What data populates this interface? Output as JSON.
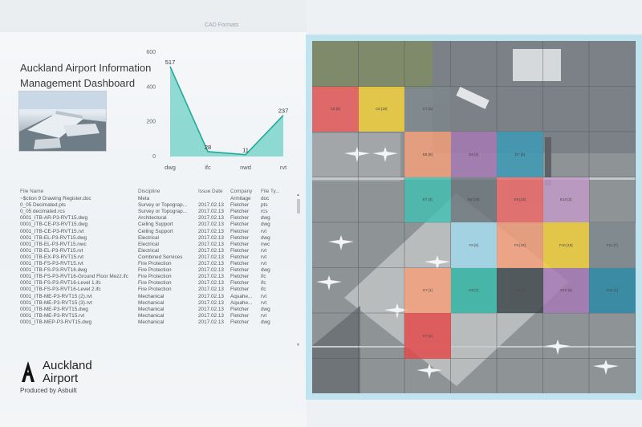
{
  "dashboard": {
    "title_line1": "Auckland Airport Information",
    "title_line2": "Management Dashboard",
    "produced_by": "Produced by Asbuilt"
  },
  "logo": {
    "line1": "Auckland",
    "line2": "Airport"
  },
  "chart_data": {
    "type": "area",
    "title": "CAD Formats",
    "categories": [
      "dwg",
      "ifc",
      "nwd",
      "rvt"
    ],
    "values": [
      517,
      28,
      11,
      237
    ],
    "ylim": [
      0,
      600
    ],
    "yticks": [
      0,
      200,
      400,
      600
    ],
    "grid": false,
    "color": "#3dc3b4"
  },
  "table": {
    "columns": [
      "File Name",
      "Discipline",
      "Issue Date",
      "Company",
      "File Ty..."
    ],
    "rows": [
      [
        "~$ction 9 Drawing Register.doc",
        "Meta",
        "",
        "Armitage",
        "doc"
      ],
      [
        "0_05 Decimated.pts",
        "Survey or Topograp...",
        "2017.02.13",
        "Fletcher",
        "pts"
      ],
      [
        "0_05 decimated.rcs",
        "Survey or Topograp...",
        "2017.02.13",
        "Fletcher",
        "rcs"
      ],
      [
        "0001_ITB-AR-P3-RVT15.dwg",
        "Architectural",
        "2017.02.13",
        "Fletcher",
        "dwg"
      ],
      [
        "0001_ITB-CE-P3-RVT15.dwg",
        "Ceiling Support",
        "2017.02.13",
        "Fletcher",
        "dwg"
      ],
      [
        "0001_ITB-CE-P3-RVT15.rvt",
        "Ceiling Support",
        "2017.02.13",
        "Fletcher",
        "rvt"
      ],
      [
        "0001_ITB-EL-P3-RVT15.dwg",
        "Electrical",
        "2017.02.13",
        "Fletcher",
        "dwg"
      ],
      [
        "0001_ITB-EL-P3-RVT15.nwc",
        "Electrical",
        "2017.02.13",
        "Fletcher",
        "nwc"
      ],
      [
        "0001_ITB-EL-P3-RVT15.rvt",
        "Electrical",
        "2017.02.13",
        "Fletcher",
        "rvt"
      ],
      [
        "0001_ITB-EX-P3-RVT15.rvt",
        "Combined Services",
        "2017.02.13",
        "Fletcher",
        "rvt"
      ],
      [
        "0001_ITB-FS-P3-RVT15.rvt",
        "Fire Protection",
        "2017.02.13",
        "Fletcher",
        "rvt"
      ],
      [
        "0001_ITB-FS-P3-RVT16.dwg",
        "Fire Protection",
        "2017.02.13",
        "Fletcher",
        "dwg"
      ],
      [
        "0001_ITB-FS-P3-RVT16-Ground Floor Mezz.ifc",
        "Fire Protection",
        "2017.02.13",
        "Fletcher",
        "ifc"
      ],
      [
        "0001_ITB-FS-P3-RVT16-Level 1.ifc",
        "Fire Protection",
        "2017.02.13",
        "Fletcher",
        "ifc"
      ],
      [
        "0001_ITB-FS-P3-RVT16-Level 2.ifc",
        "Fire Protection",
        "2017.02.13",
        "Fletcher",
        "ifc"
      ],
      [
        "0001_ITB-ME-P3-RVT15 (2).rvt",
        "Mechanical",
        "2017.02.13",
        "Aquahe...",
        "rvt"
      ],
      [
        "0001_ITB-ME-P3-RVT15 (3).rvt",
        "Mechanical",
        "2017.02.13",
        "Aquahe...",
        "rvt"
      ],
      [
        "0001_ITB-ME-P3-RVT15.dwg",
        "Mechanical",
        "2017.02.13",
        "Fletcher",
        "dwg"
      ],
      [
        "0001_ITB-ME-P3-RVT15.rvt",
        "Mechanical",
        "2017.02.13",
        "Fletcher",
        "rvt"
      ],
      [
        "0001_ITB-MEP-P3-RVT15.dwg",
        "Mechanical",
        "2017.02.13",
        "Fletcher",
        "dwg"
      ]
    ]
  },
  "map": {
    "zones": [
      {
        "label": "C5 [8]",
        "col": 0,
        "row": 1,
        "color": "#f0605e"
      },
      {
        "label": "C6 [19]",
        "col": 1,
        "row": 1,
        "color": "#f4d23a"
      },
      {
        "label": "C7 [5]",
        "col": 2,
        "row": 1,
        "color": "#7d878c"
      },
      {
        "label": "D5 [9]",
        "col": 2,
        "row": 2,
        "color": "#f6a07a"
      },
      {
        "label": "D6 [5]",
        "col": 3,
        "row": 2,
        "color": "#a77ab6"
      },
      {
        "label": "D7 [9]",
        "col": 4,
        "row": 2,
        "color": "#3b9bb8"
      },
      {
        "label": "E7 [4]",
        "col": 2,
        "row": 3,
        "color": "#43c0b2"
      },
      {
        "label": "E8 [18]",
        "col": 3,
        "row": 3,
        "color": "#6c767b"
      },
      {
        "label": "E9 [18]",
        "col": 4,
        "row": 3,
        "color": "#f06a68"
      },
      {
        "label": "E10 [2]",
        "col": 5,
        "row": 3,
        "color": "#c39bc9"
      },
      {
        "label": "F8 [5]",
        "col": 3,
        "row": 4,
        "color": "#9fd9ec"
      },
      {
        "label": "F9 [18]",
        "col": 4,
        "row": 4,
        "color": "#f6a07a"
      },
      {
        "label": "F10 [15]",
        "col": 5,
        "row": 4,
        "color": "#f4d23a"
      },
      {
        "label": "F11 [7]",
        "col": 6,
        "row": 4,
        "color": "#7f8a8e"
      },
      {
        "label": "G7 [1]",
        "col": 2,
        "row": 5,
        "color": "#f6a07a"
      },
      {
        "label": "G8 [7]",
        "col": 3,
        "row": 5,
        "color": "#2fb5a5"
      },
      {
        "label": "G9 [2]",
        "col": 4,
        "row": 5,
        "color": "#3b4448"
      },
      {
        "label": "G10 [2]",
        "col": 5,
        "row": 5,
        "color": "#a77ab6"
      },
      {
        "label": "G11 [1]",
        "col": 6,
        "row": 5,
        "color": "#2a8aa8"
      },
      {
        "label": "H7 [2]",
        "col": 2,
        "row": 6,
        "color": "#e54848"
      }
    ]
  }
}
